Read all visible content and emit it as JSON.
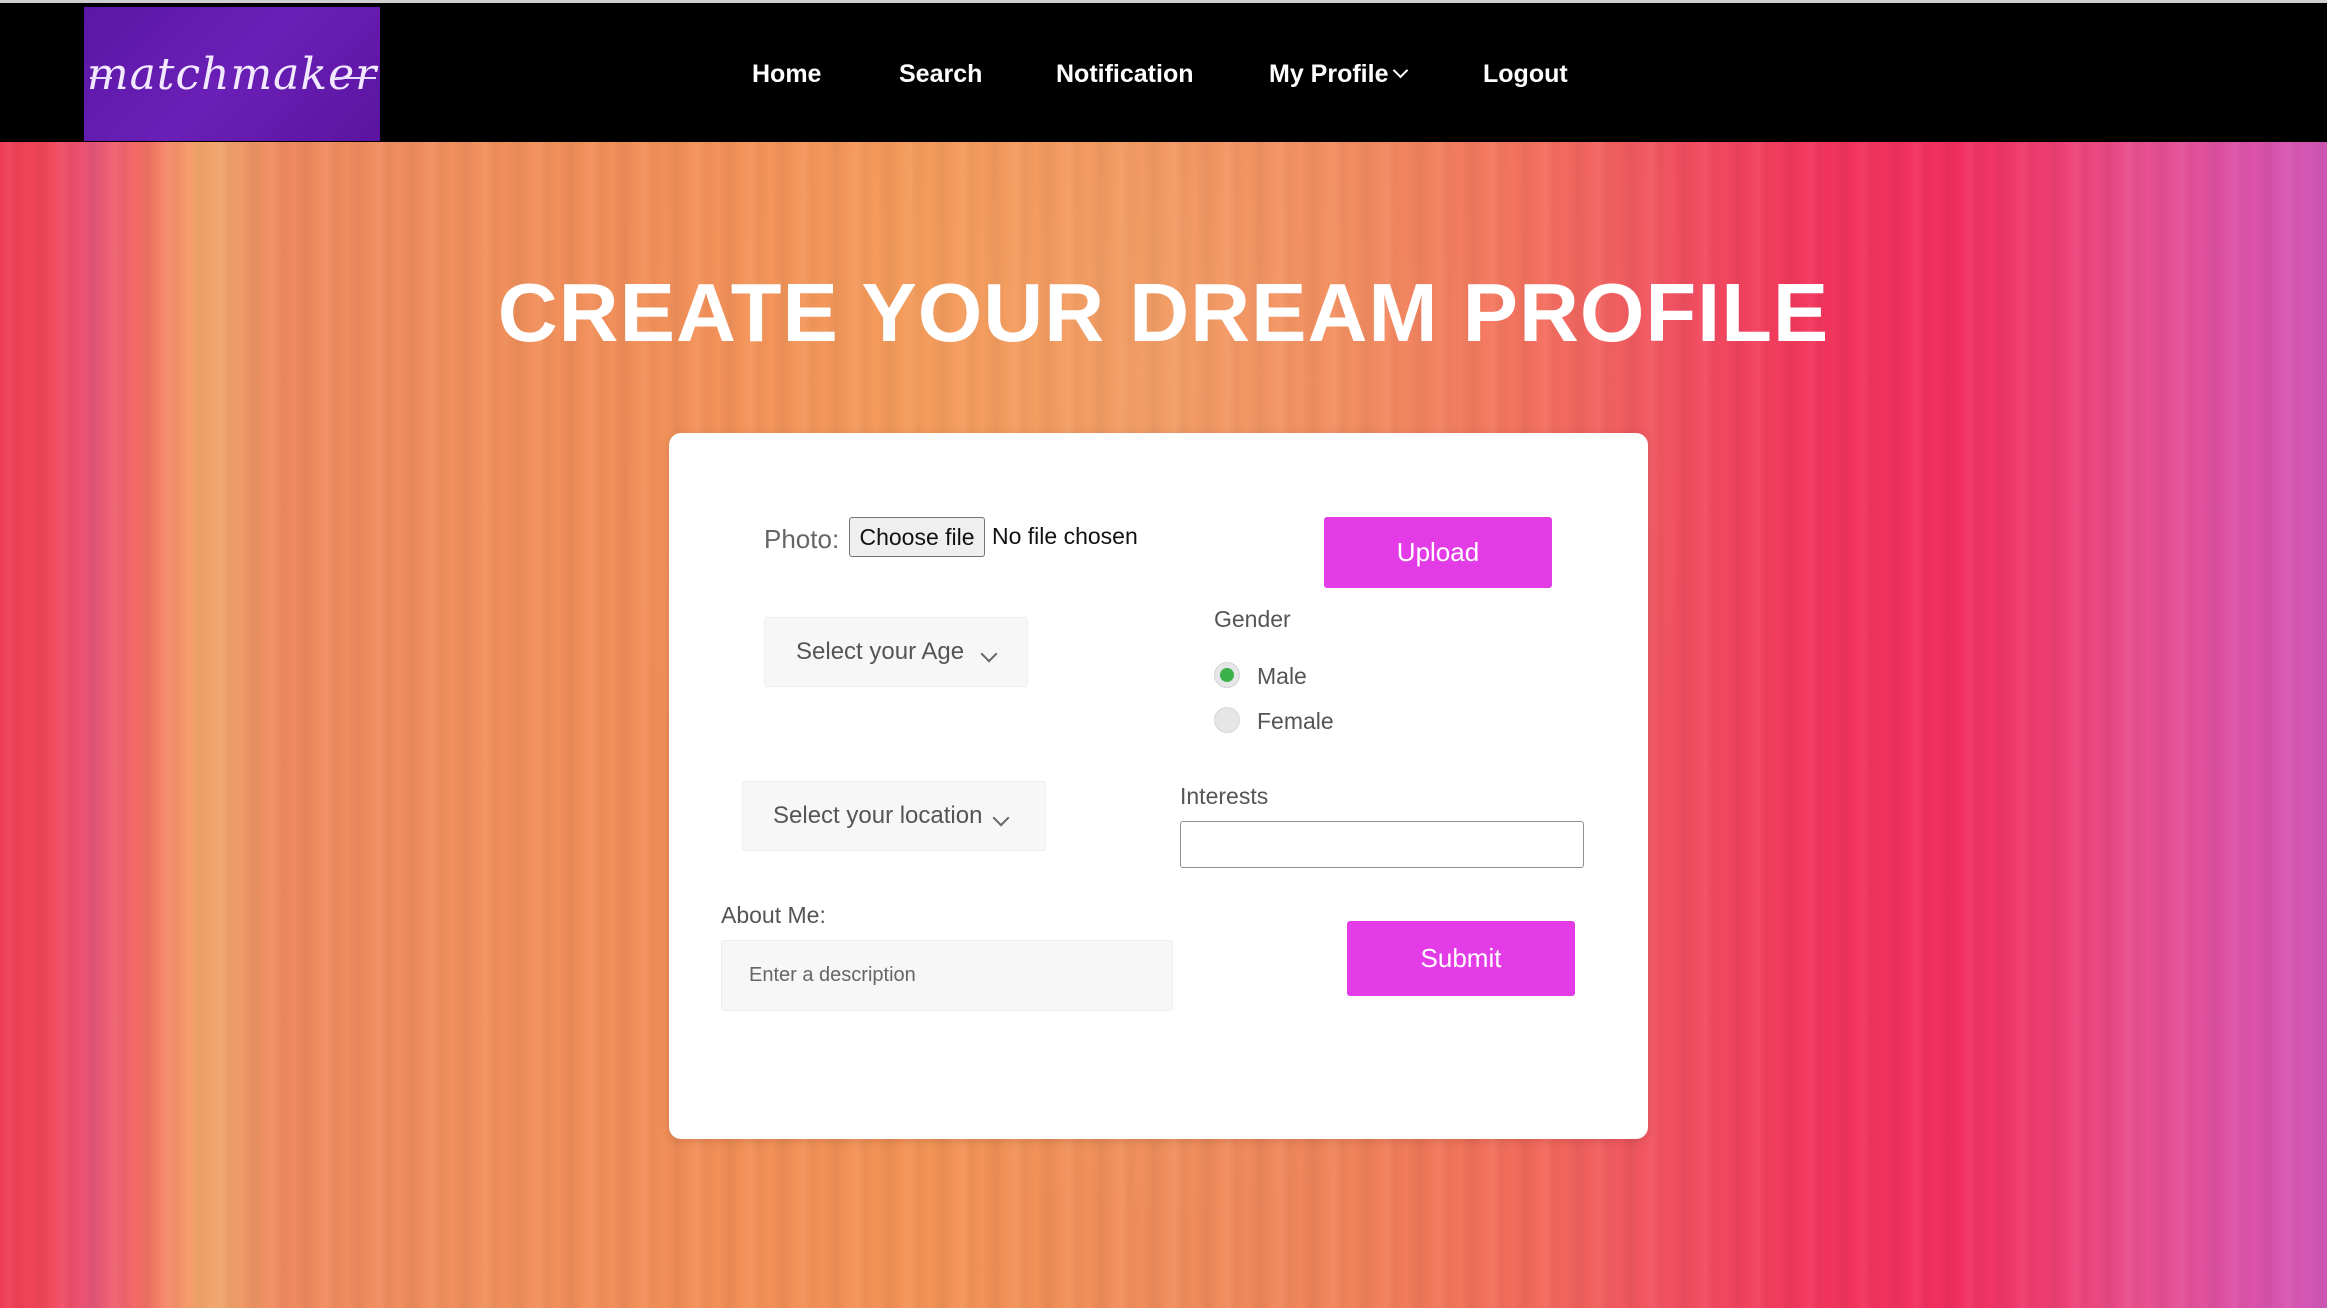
{
  "brand": {
    "logo_text": "matchmaker",
    "logo_color": "#5a17a5"
  },
  "nav": {
    "home": "Home",
    "search": "Search",
    "notification": "Notification",
    "my_profile": "My Profile",
    "logout": "Logout"
  },
  "hero": {
    "title": "CREATE YOUR DREAM PROFILE"
  },
  "form": {
    "photo_label": "Photo:",
    "choose_file": "Choose file",
    "file_status": "No file chosen",
    "upload": "Upload",
    "age_select": "Select your Age",
    "gender_label": "Gender",
    "gender_options": [
      {
        "label": "Male",
        "selected": true
      },
      {
        "label": "Female",
        "selected": false
      }
    ],
    "location_select": "Select your location",
    "interests_label": "Interests",
    "interests_value": "",
    "about_label": "About Me:",
    "about_placeholder": "Enter a description",
    "submit": "Submit",
    "accent_color": "#e33ce6",
    "radio_selected_color": "#3cb04a"
  }
}
